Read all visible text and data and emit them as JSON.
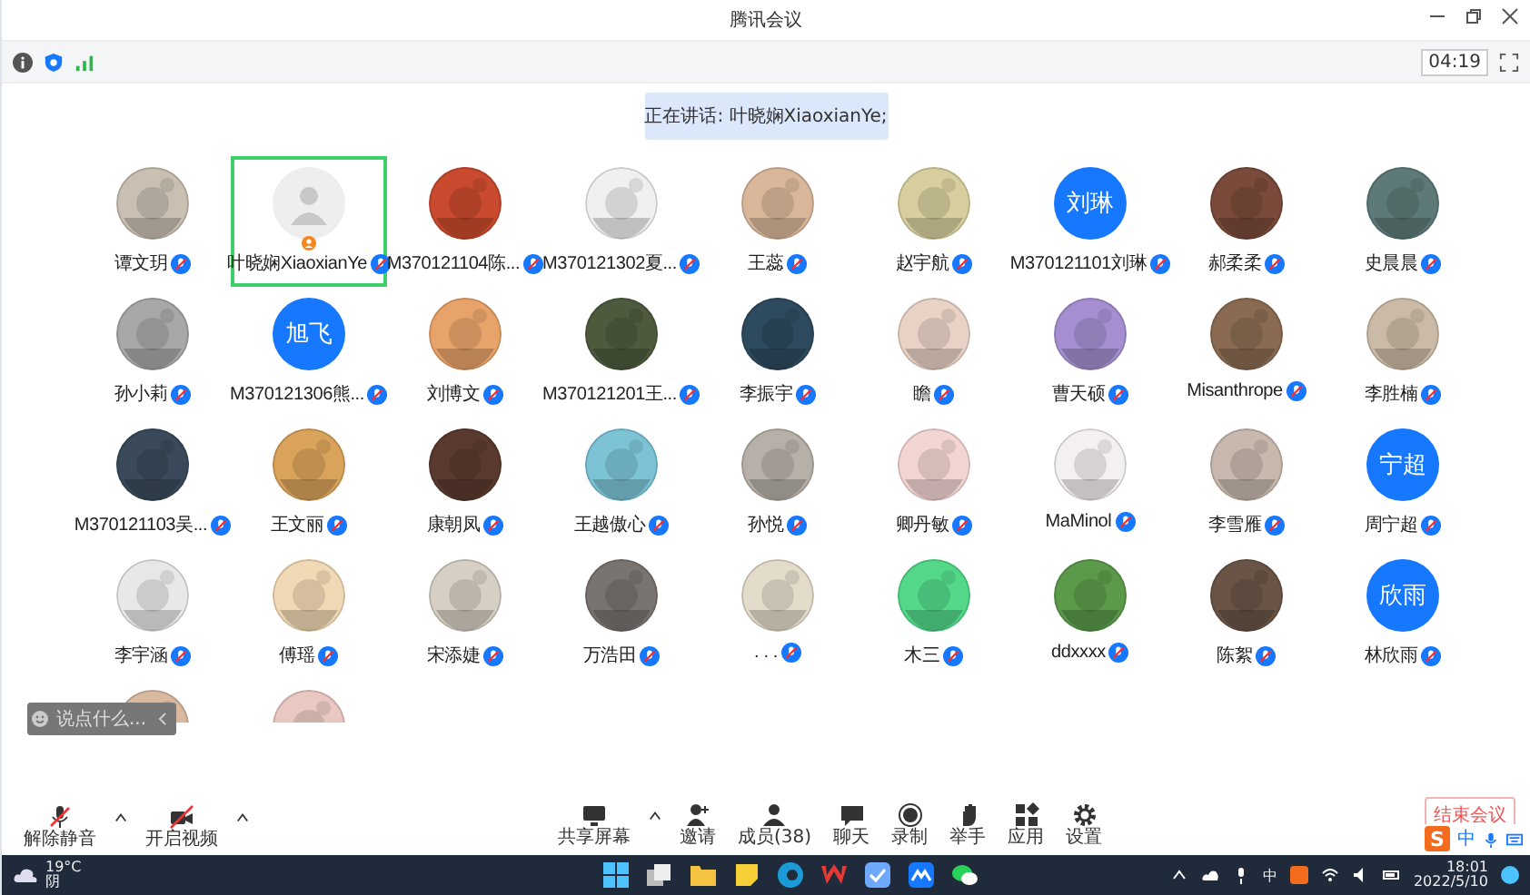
{
  "window": {
    "title": "腾讯会议",
    "timer": "04:19"
  },
  "speaking": "正在讲话: 叶晓娴XiaoxianYe;",
  "participants": [
    {
      "name": "谭文玥",
      "selected": false
    },
    {
      "name": "叶晓娴XiaoxianYe",
      "avatar": {
        "kind": "default",
        "color": "#eeeeee"
      },
      "selected": true
    },
    {
      "name": "M370121104陈...",
      "selected": false
    },
    {
      "name": "M370121302夏...",
      "selected": false
    },
    {
      "name": "王蕊",
      "selected": false
    },
    {
      "name": "赵宇航",
      "selected": false
    },
    {
      "name": "M370121101刘琳",
      "avatar": {
        "kind": "text",
        "color": "#1677ff",
        "text": "刘琳"
      },
      "selected": false
    },
    {
      "name": "郝柔柔",
      "selected": false
    },
    {
      "name": "史晨晨",
      "selected": false
    },
    {
      "name": "孙小莉",
      "selected": false
    },
    {
      "name": "M370121306熊...",
      "avatar": {
        "kind": "text",
        "color": "#1677ff",
        "text": "旭飞"
      },
      "selected": false
    },
    {
      "name": "刘博文",
      "selected": false
    },
    {
      "name": "M370121201王...",
      "selected": false
    },
    {
      "name": "李振宇",
      "selected": false
    },
    {
      "name": "瞻",
      "selected": false
    },
    {
      "name": "曹天硕",
      "selected": false
    },
    {
      "name": "Misanthrope",
      "selected": false
    },
    {
      "name": "李胜楠",
      "selected": false
    },
    {
      "name": "M370121103吴...",
      "selected": false
    },
    {
      "name": "王文丽",
      "selected": false
    },
    {
      "name": "康朝凤",
      "selected": false
    },
    {
      "name": "王越傲心",
      "selected": false
    },
    {
      "name": "孙悦",
      "selected": false
    },
    {
      "name": "卿丹敏",
      "selected": false
    },
    {
      "name": "MaMinol",
      "selected": false
    },
    {
      "name": "李雪雁",
      "selected": false
    },
    {
      "name": "周宁超",
      "avatar": {
        "kind": "text",
        "color": "#1677ff",
        "text": "宁超"
      },
      "selected": false
    },
    {
      "name": "李宇涵",
      "selected": false
    },
    {
      "name": "傅瑶",
      "selected": false
    },
    {
      "name": "宋添婕",
      "selected": false
    },
    {
      "name": "万浩田",
      "selected": false
    },
    {
      "name": ". . .",
      "selected": false
    },
    {
      "name": "木三",
      "selected": false
    },
    {
      "name": "ddxxxx",
      "selected": false
    },
    {
      "name": "陈絮",
      "selected": false
    },
    {
      "name": "林欣雨",
      "avatar": {
        "kind": "text",
        "color": "#1677ff",
        "text": "欣雨"
      },
      "selected": false
    },
    {
      "selected": false
    },
    {
      "selected": false
    }
  ],
  "chat_input": {
    "placeholder": "说点什么..."
  },
  "toolbar_left": [
    {
      "kind": "mic",
      "label": "解除静音",
      "has_menu": true
    },
    {
      "kind": "camera",
      "label": "开启视频",
      "has_menu": true
    }
  ],
  "toolbar_center": [
    {
      "kind": "screen",
      "label": "共享屏幕",
      "has_menu": true
    },
    {
      "kind": "invite",
      "label": "邀请",
      "has_menu": false
    },
    {
      "kind": "members",
      "label": "成员(38)",
      "has_menu": false
    },
    {
      "kind": "chat",
      "label": "聊天",
      "has_menu": false
    },
    {
      "kind": "record",
      "label": "录制",
      "has_menu": false
    },
    {
      "kind": "hand",
      "label": "举手",
      "has_menu": false
    },
    {
      "kind": "apps",
      "label": "应用",
      "has_menu": false
    },
    {
      "kind": "gear",
      "label": "设置",
      "has_menu": false
    }
  ],
  "end_button": "结束会议",
  "ime_bar": {
    "logo": "S",
    "mode": "中"
  },
  "taskbar": {
    "weather": {
      "temp": "19°C",
      "desc": "阴"
    },
    "tray_lang": "中",
    "time": "18:01",
    "date": "2022/5/10"
  }
}
